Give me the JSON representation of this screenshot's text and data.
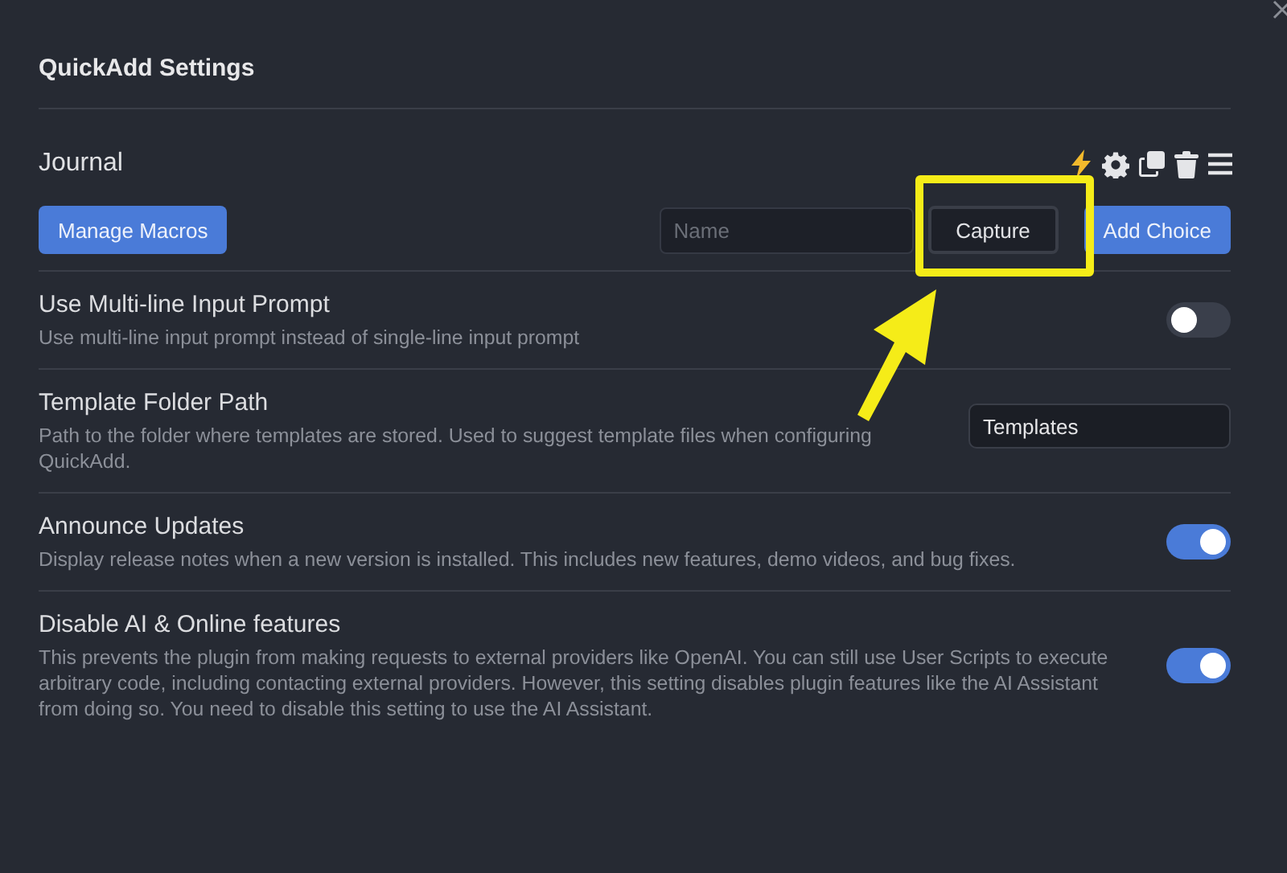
{
  "window": {
    "title": "QuickAdd Settings"
  },
  "choice": {
    "name": "Journal"
  },
  "toolbar": {
    "manage_button": "Manage Macros",
    "name_field": {
      "placeholder": "Name"
    },
    "type_button": "Capture",
    "add_button": "Add Choice"
  },
  "settings": [
    {
      "kind": "toggle",
      "name": "Use Multi-line Input Prompt",
      "description": "Use multi-line input prompt instead of single-line input prompt",
      "on": false
    },
    {
      "kind": "text",
      "name": "Template Folder Path",
      "description": "Path to the folder where templates are stored. Used to suggest template files when configuring QuickAdd.",
      "value": "Templates"
    },
    {
      "kind": "toggle",
      "name": "Announce Updates",
      "description": "Display release notes when a new version is installed. This includes new features, demo videos, and bug fixes.",
      "on": true
    },
    {
      "kind": "toggle",
      "name": "Disable AI & Online features",
      "description": "This prevents the plugin from making requests to external providers like OpenAI. You can still use User Scripts to execute arbitrary code, including contacting external providers. However, this setting disables plugin features like the AI Assistant from doing so. You need to disable this setting to use the AI Assistant.",
      "on": true
    }
  ]
}
